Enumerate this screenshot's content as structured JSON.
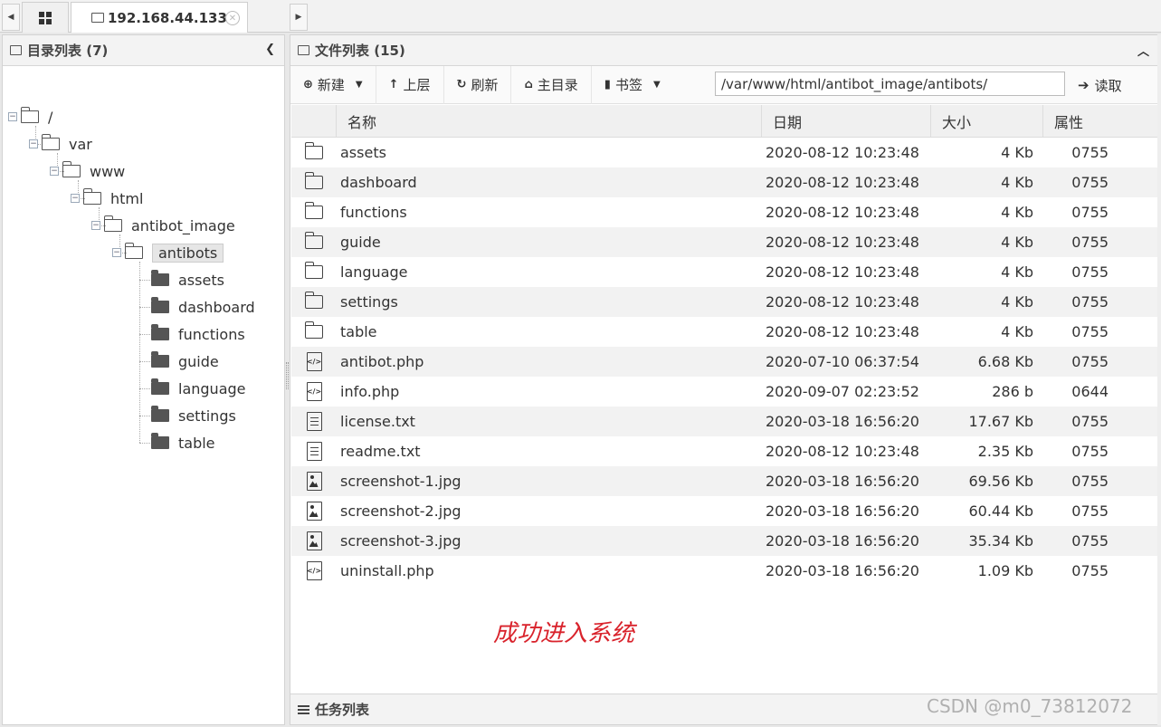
{
  "tabs": {
    "ip_tab": "192.168.44.133"
  },
  "left_panel": {
    "title": "目录列表 (7)",
    "tree": {
      "root": "/",
      "var": "var",
      "www": "www",
      "html": "html",
      "antibot_image": "antibot_image",
      "antibots": "antibots",
      "children": [
        "assets",
        "dashboard",
        "functions",
        "guide",
        "language",
        "settings",
        "table"
      ]
    }
  },
  "right_panel": {
    "title": "文件列表 (15)",
    "toolbar": {
      "new_label": "新建",
      "up_label": "上层",
      "refresh_label": "刷新",
      "home_label": "主目录",
      "bookmark_label": "书签",
      "path_value": "/var/www/html/antibot_image/antibots/",
      "read_label": "读取"
    },
    "columns": {
      "name": "名称",
      "date": "日期",
      "size": "大小",
      "attr": "属性"
    },
    "files": [
      {
        "type": "folder",
        "name": "assets",
        "date": "2020-08-12 10:23:48",
        "size": "4 Kb",
        "attr": "0755"
      },
      {
        "type": "folder",
        "name": "dashboard",
        "date": "2020-08-12 10:23:48",
        "size": "4 Kb",
        "attr": "0755"
      },
      {
        "type": "folder",
        "name": "functions",
        "date": "2020-08-12 10:23:48",
        "size": "4 Kb",
        "attr": "0755"
      },
      {
        "type": "folder",
        "name": "guide",
        "date": "2020-08-12 10:23:48",
        "size": "4 Kb",
        "attr": "0755"
      },
      {
        "type": "folder",
        "name": "language",
        "date": "2020-08-12 10:23:48",
        "size": "4 Kb",
        "attr": "0755"
      },
      {
        "type": "folder",
        "name": "settings",
        "date": "2020-08-12 10:23:48",
        "size": "4 Kb",
        "attr": "0755"
      },
      {
        "type": "folder",
        "name": "table",
        "date": "2020-08-12 10:23:48",
        "size": "4 Kb",
        "attr": "0755"
      },
      {
        "type": "code",
        "name": "antibot.php",
        "date": "2020-07-10 06:37:54",
        "size": "6.68 Kb",
        "attr": "0755"
      },
      {
        "type": "code",
        "name": "info.php",
        "date": "2020-09-07 02:23:52",
        "size": "286 b",
        "attr": "0644"
      },
      {
        "type": "text",
        "name": "license.txt",
        "date": "2020-03-18 16:56:20",
        "size": "17.67 Kb",
        "attr": "0755"
      },
      {
        "type": "text",
        "name": "readme.txt",
        "date": "2020-08-12 10:23:48",
        "size": "2.35 Kb",
        "attr": "0755"
      },
      {
        "type": "image",
        "name": "screenshot-1.jpg",
        "date": "2020-03-18 16:56:20",
        "size": "69.56 Kb",
        "attr": "0755"
      },
      {
        "type": "image",
        "name": "screenshot-2.jpg",
        "date": "2020-03-18 16:56:20",
        "size": "60.44 Kb",
        "attr": "0755"
      },
      {
        "type": "image",
        "name": "screenshot-3.jpg",
        "date": "2020-03-18 16:56:20",
        "size": "35.34 Kb",
        "attr": "0755"
      },
      {
        "type": "code",
        "name": "uninstall.php",
        "date": "2020-03-18 16:56:20",
        "size": "1.09 Kb",
        "attr": "0755"
      }
    ],
    "annotation": "成功进入系统",
    "task_list_title": "任务列表"
  },
  "watermark": "CSDN @m0_73812072",
  "colors": {
    "annotation": "#d9232c",
    "alt_row": "#f2f2f2"
  }
}
